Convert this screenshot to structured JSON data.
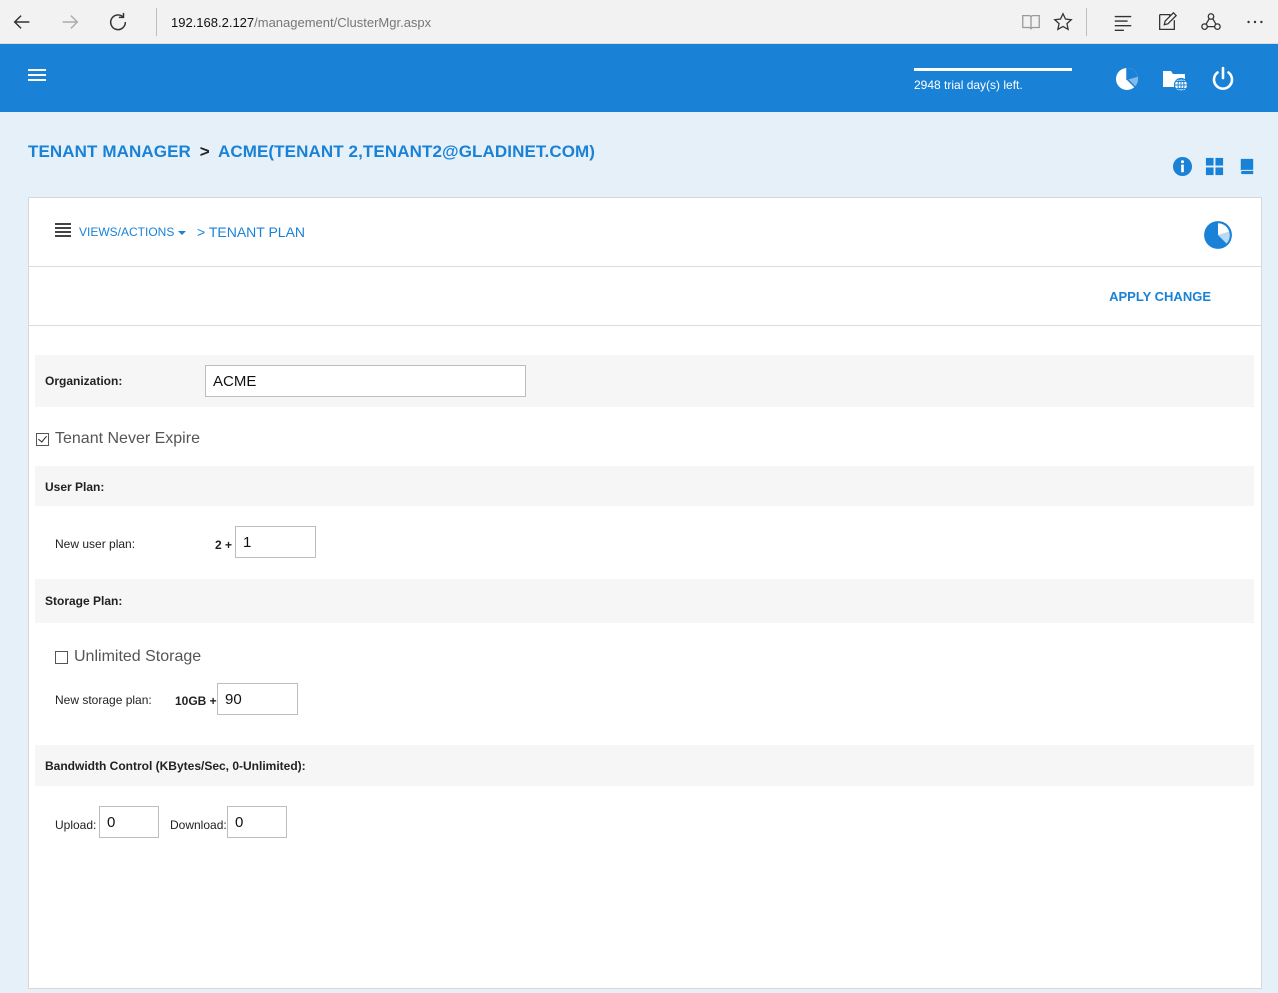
{
  "browser": {
    "url_host": "192.168.2.127",
    "url_path": "/management/ClusterMgr.aspx"
  },
  "header": {
    "trial_text": "2948 trial day(s) left.",
    "accent_color": "#1a82d6"
  },
  "breadcrumb": {
    "root": "TENANT MANAGER",
    "separator": ">",
    "current": "ACME(TENANT 2,TENANT2@GLADINET.COM)"
  },
  "panel": {
    "views_actions": "VIEWS/ACTIONS",
    "section_title": "> TENANT PLAN",
    "apply_change": "APPLY CHANGE"
  },
  "form": {
    "organization_label": "Organization:",
    "organization_value": "ACME",
    "never_expire_label": "Tenant Never Expire",
    "never_expire_checked": true,
    "user_plan_header": "User Plan:",
    "new_user_plan_label": "New user plan:",
    "user_plan_prefix": "2 +",
    "user_plan_value": "1",
    "storage_plan_header": "Storage Plan:",
    "unlimited_storage_label": "Unlimited Storage",
    "unlimited_storage_checked": false,
    "new_storage_plan_label": "New storage plan:",
    "storage_plan_prefix": "10GB +",
    "storage_plan_value": "90",
    "bandwidth_header": "Bandwidth Control (KBytes/Sec, 0-Unlimited):",
    "upload_label": "Upload:",
    "upload_value": "0",
    "download_label": "Download:",
    "download_value": "0"
  }
}
